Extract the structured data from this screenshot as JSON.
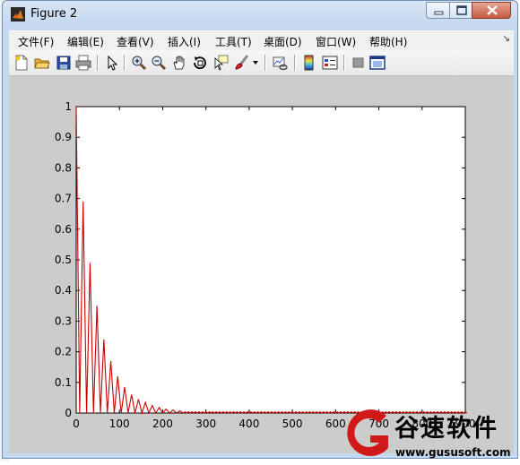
{
  "window": {
    "title": "Figure 2"
  },
  "menu": {
    "items": [
      "文件(F)",
      "编辑(E)",
      "查看(V)",
      "插入(I)",
      "工具(T)",
      "桌面(D)",
      "窗口(W)",
      "帮助(H)"
    ],
    "overflow_icon": "chevron-icon"
  },
  "toolbar": {
    "icons": [
      "new-figure-icon",
      "open-file-icon",
      "save-icon",
      "print-icon",
      "pointer-icon",
      "zoom-in-icon",
      "zoom-out-icon",
      "pan-icon",
      "rotate-3d-icon",
      "data-cursor-icon",
      "brush-icon",
      "link-plot-icon",
      "colorbar-icon",
      "legend-icon",
      "hide-plot-tools-icon",
      "show-plot-tools-icon"
    ]
  },
  "chart_data": {
    "type": "line",
    "title": "",
    "xlabel": "",
    "ylabel": "",
    "xlim": [
      0,
      900
    ],
    "ylim": [
      0,
      1
    ],
    "xticks": [
      "0",
      "100",
      "200",
      "300",
      "400",
      "500",
      "600",
      "700",
      "800",
      "900"
    ],
    "yticks": [
      "0",
      "0.1",
      "0.2",
      "0.3",
      "0.4",
      "0.5",
      "0.6",
      "0.7",
      "0.8",
      "0.9",
      "1"
    ],
    "grid": false,
    "series": [
      {
        "color": "#cc0000",
        "description_free_peaks": {
          "x": [
            0,
            16,
            32,
            48,
            64,
            80,
            96,
            112,
            128,
            144,
            160,
            176,
            192,
            208,
            224,
            240
          ],
          "y": [
            1.0,
            0.69,
            0.49,
            0.35,
            0.24,
            0.17,
            0.12,
            0.085,
            0.06,
            0.045,
            0.035,
            0.025,
            0.018,
            0.013,
            0.01,
            0.007
          ]
        }
      }
    ]
  },
  "watermark": {
    "brand": "谷速软件",
    "url": "www.gususoft.com"
  }
}
